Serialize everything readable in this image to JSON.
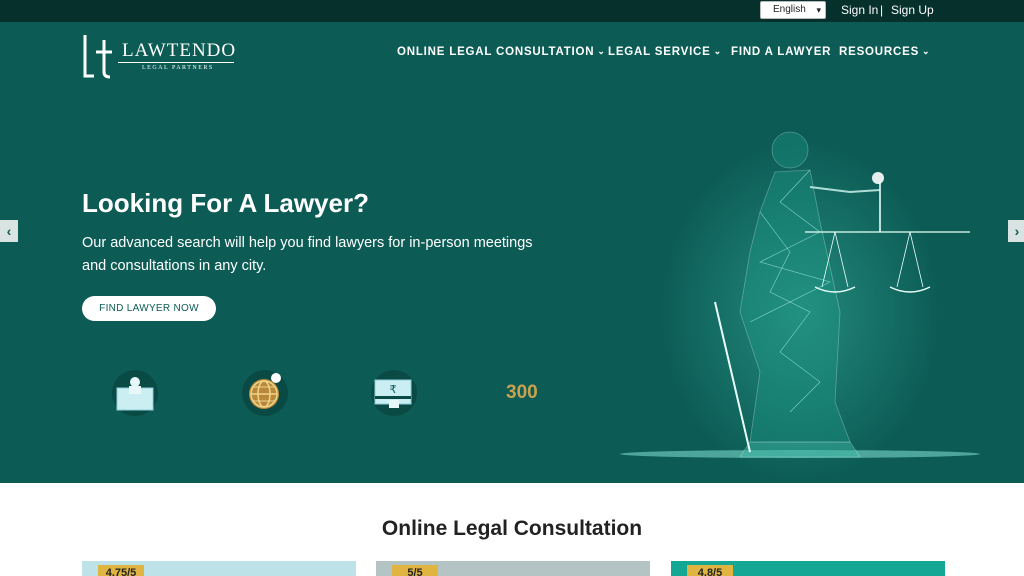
{
  "topbar": {
    "language": "English",
    "sign_in": "Sign In",
    "separator": "|",
    "sign_up": "Sign Up"
  },
  "logo": {
    "name": "LAWTENDO",
    "tagline": "LEGAL PARTNERS"
  },
  "nav": {
    "items": [
      {
        "label": "ONLINE LEGAL CONSULTATION",
        "has_dropdown": true
      },
      {
        "label": "LEGAL SERVICE",
        "has_dropdown": true
      },
      {
        "label": "FIND A LAWYER",
        "has_dropdown": false
      },
      {
        "label": "RESOURCES",
        "has_dropdown": true
      }
    ],
    "chevron": "⌄"
  },
  "hero": {
    "title": "Looking For A Lawyer?",
    "description": "Our advanced search will help you find lawyers for in-person meetings and consultations in any city.",
    "cta": "FIND LAWYER NOW",
    "prev_arrow": "‹",
    "next_arrow": "›",
    "features": [
      {
        "icon": "lawyer-desk-icon"
      },
      {
        "icon": "globe-location-icon"
      },
      {
        "icon": "rupee-payment-icon"
      }
    ],
    "stat": "300",
    "illustration": "lady-justice-scales-icon"
  },
  "consultation": {
    "title": "Online Legal Consultation",
    "cards": [
      {
        "rating": "4.75/5",
        "color": "#bde3e8"
      },
      {
        "rating": "5/5",
        "color": "#b4c4c4"
      },
      {
        "rating": "4.8/5",
        "color": "#14a793"
      }
    ]
  },
  "colors": {
    "topbar_bg": "#05302b",
    "hero_bg": "#0c5c55",
    "accent_gold": "#c8a24e",
    "rating_badge": "#e0b441"
  }
}
